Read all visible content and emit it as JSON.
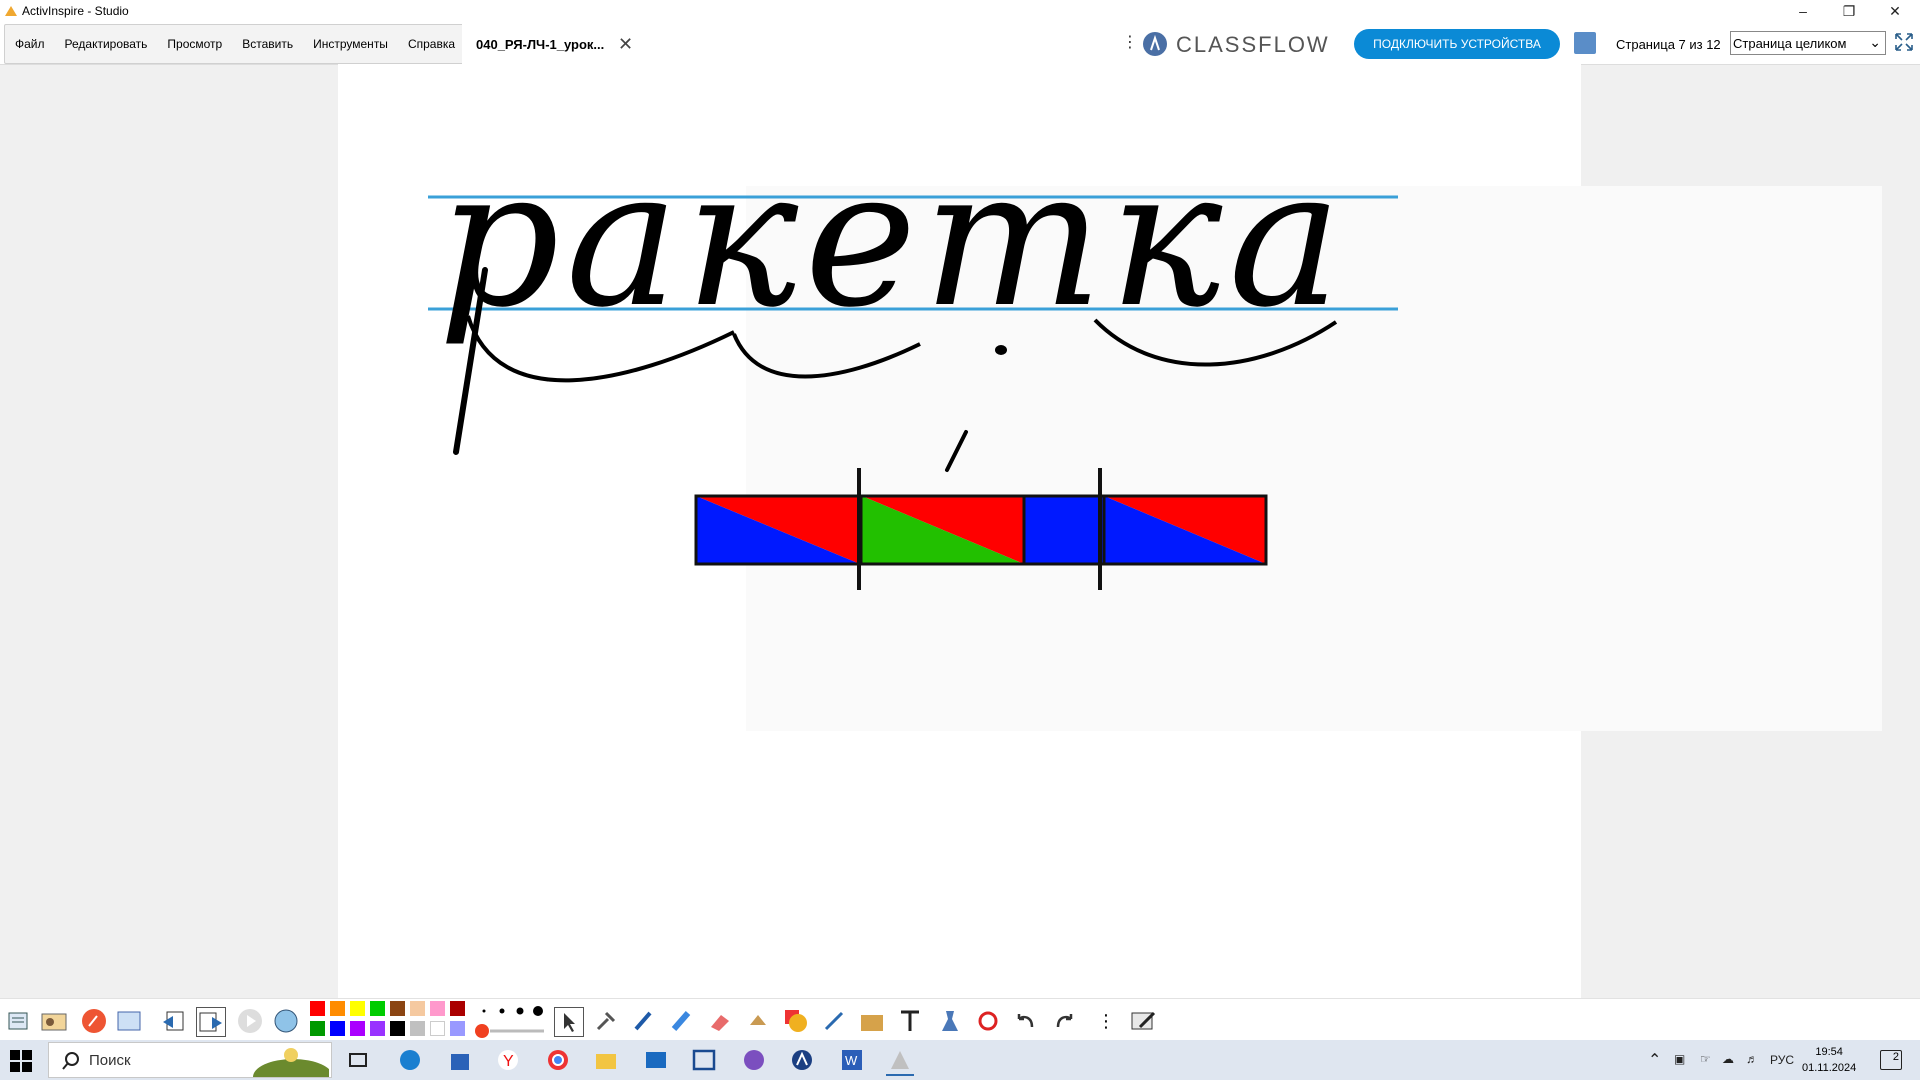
{
  "window": {
    "title": "ActivInspire - Studio"
  },
  "menu": [
    "Файл",
    "Редактировать",
    "Просмотр",
    "Вставить",
    "Инструменты",
    "Справка"
  ],
  "doc_tab": {
    "label": "040_РЯ-ЛЧ-1_урок..."
  },
  "classflow": {
    "logo": "CLASSFLOW",
    "connect_label": "ПОДКЛЮЧИТЬ УСТРОЙСТВА"
  },
  "page_info": "Страница 7 из 12",
  "zoom": {
    "selected": "Страница целиком"
  },
  "canvas": {
    "word": "ракетка",
    "scheme_colors": {
      "red": "#ff0000",
      "blue": "#0019ff",
      "green": "#22c000"
    }
  },
  "palette": [
    "#ff0000",
    "#ff8c00",
    "#ffff00",
    "#00cc00",
    "#8b4513",
    "#f5c9a0",
    "#ff99cc",
    "#aa0000",
    "#009900",
    "#0000ff",
    "#aa00ff",
    "#9933ff",
    "#000000",
    "#c0c0c0",
    "#ffffff",
    "#9999ff"
  ],
  "taskbar": {
    "search_placeholder": "Поиск",
    "lang": "РУС",
    "time": "19:54",
    "date": "01.11.2024",
    "notifications": "2"
  }
}
